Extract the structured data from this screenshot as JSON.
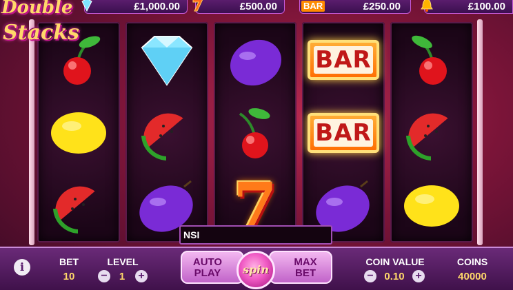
{
  "game": {
    "logo_line1": "Double",
    "logo_line2": "Stacks"
  },
  "payouts": [
    {
      "icon": "diamond-icon",
      "amount": "£1,000.00"
    },
    {
      "icon": "seven-icon",
      "amount": "£500.00"
    },
    {
      "icon": "bar-icon",
      "icon_text": "BAR",
      "amount": "£250.00"
    },
    {
      "icon": "bell-icon",
      "amount": "£100.00"
    }
  ],
  "reels": [
    [
      "cherry",
      "lemon",
      "watermelon"
    ],
    [
      "diamond",
      "watermelon",
      "plum"
    ],
    [
      "plum",
      "cherry",
      "seven"
    ],
    [
      "bar",
      "bar",
      "plum"
    ],
    [
      "cherry",
      "watermelon",
      "lemon"
    ]
  ],
  "bar_text": "BAR",
  "seven_text": "7",
  "message": "NSI",
  "controls": {
    "info": "i",
    "bet_label": "BET",
    "bet_value": "10",
    "level_label": "LEVEL",
    "level_value": "1",
    "minus": "−",
    "plus": "+",
    "autoplay_line1": "AUTO",
    "autoplay_line2": "PLAY",
    "spin_label": "spin",
    "maxbet_line1": "MAX",
    "maxbet_line2": "BET",
    "coin_value_label": "COIN VALUE",
    "coin_value": "0.10",
    "coins_label": "COINS",
    "coins_value": "40000"
  },
  "colors": {
    "accent": "#c75ad9",
    "gold": "#ffd86a",
    "panel": "#3e1049"
  }
}
